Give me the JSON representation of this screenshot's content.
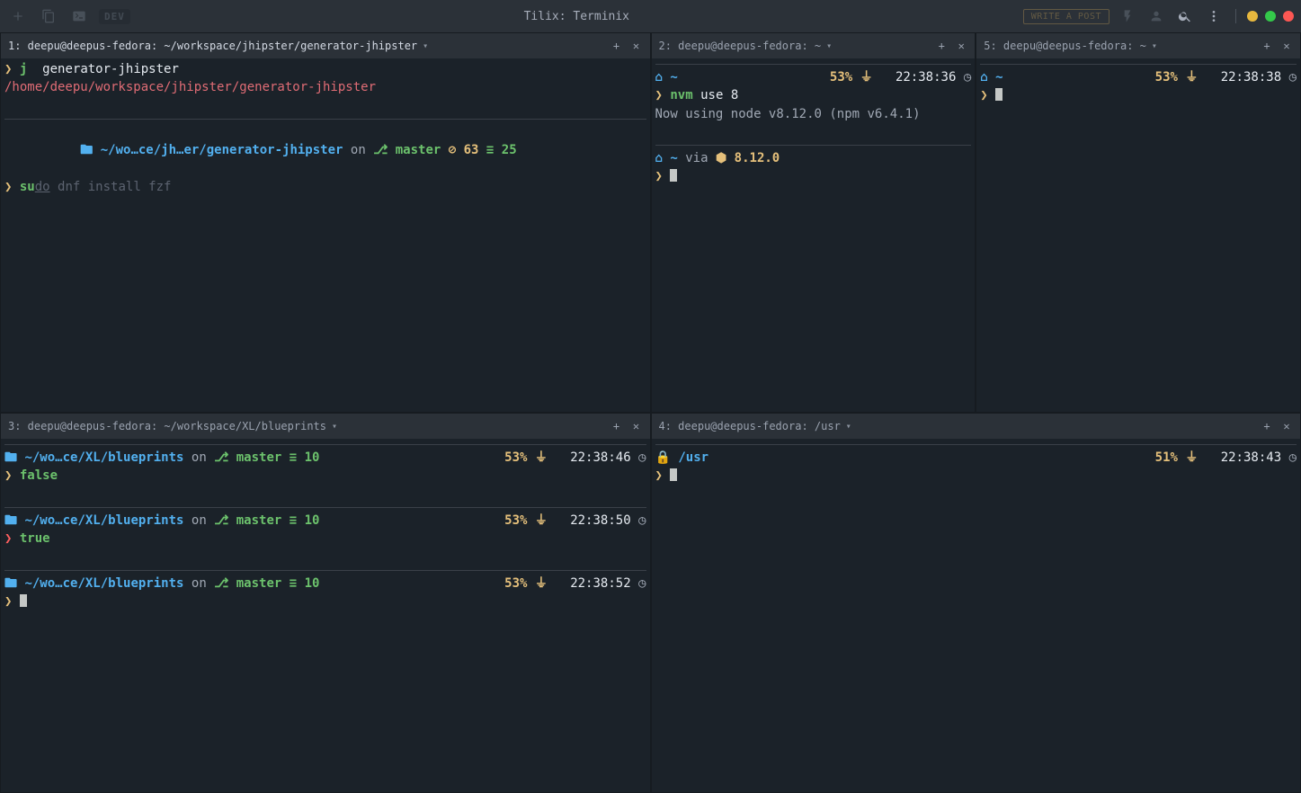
{
  "window": {
    "title": "Tilix: Terminix"
  },
  "titlebar": {
    "dev_badge": "DEV",
    "write_post": "WRITE A POST"
  },
  "panes": {
    "p1": {
      "tab_title": "1: deepu@deepus-fedora: ~/workspace/jhipster/generator-jhipster",
      "cmd1_prefix": "j",
      "cmd1_arg": "generator-jhipster",
      "path_echo": "/home/deepu/workspace/jhipster/generator-jhipster",
      "prompt_path": "~/wo…ce/jh…er/generator-jhipster",
      "on": "on",
      "branch": "master",
      "behind": "63",
      "stash": "25",
      "cmd2_sudo": "su",
      "cmd2_do": "do",
      "cmd2_suggest": "dnf install fzf"
    },
    "p2": {
      "tab_title": "2: deepu@deepus-fedora: ~",
      "battery": "53%",
      "time": "22:38:36",
      "cmd": "nvm",
      "cmd_args": "use 8",
      "output": "Now using node v8.12.0 (npm v6.4.1)",
      "via": "via",
      "node_ver": "8.12.0"
    },
    "p5": {
      "tab_title": "5: deepu@deepus-fedora: ~",
      "battery": "53%",
      "time": "22:38:38"
    },
    "p3": {
      "tab_title": "3: deepu@deepus-fedora: ~/workspace/XL/blueprints",
      "prompt_path": "~/wo…ce/XL/blueprints",
      "on": "on",
      "branch": "master",
      "stash": "10",
      "entries": [
        {
          "battery": "53%",
          "time": "22:38:46",
          "cmd": "false",
          "fail": false
        },
        {
          "battery": "53%",
          "time": "22:38:50",
          "cmd": "true",
          "fail": true
        },
        {
          "battery": "53%",
          "time": "22:38:52",
          "cmd": "",
          "fail": false
        }
      ]
    },
    "p4": {
      "tab_title": "4: deepu@deepus-fedora: /usr",
      "path": "/usr",
      "battery": "51%",
      "time": "22:38:43"
    }
  },
  "glyph": {
    "home": "⌂",
    "tilde": "~",
    "folder": "🖿",
    "git": "",
    "branch": "⎇",
    "clock": "◷",
    "lock": "🔒",
    "plug": "⏚",
    "hex": "⬢",
    "down": "▾",
    "plus": "+",
    "close": "✕",
    "arrow": "❯"
  }
}
